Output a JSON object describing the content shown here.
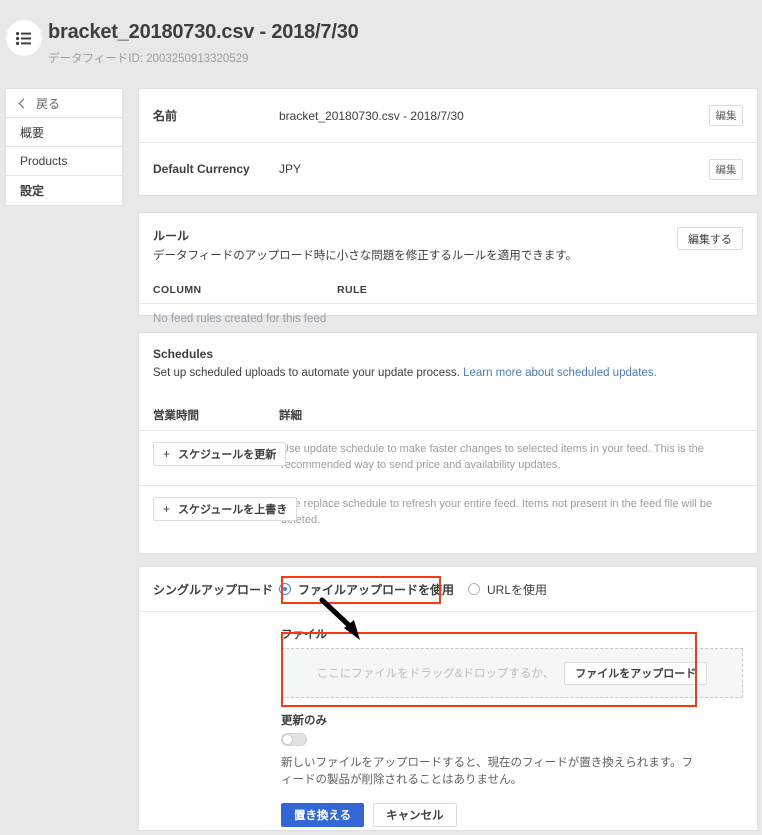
{
  "header": {
    "icon": "list-icon",
    "title": "bracket_20180730.csv - 2018/7/30",
    "subtitle": "データフィードID: 2003250913320529"
  },
  "sidebar": {
    "items": [
      {
        "label": "戻る",
        "icon": "chevron-left-icon",
        "selected": false
      },
      {
        "label": "概要",
        "selected": false
      },
      {
        "label": "Products",
        "selected": false
      },
      {
        "label": "設定",
        "selected": true
      }
    ]
  },
  "basic_card": {
    "rows": [
      {
        "label": "名前",
        "value": "bracket_20180730.csv - 2018/7/30",
        "action": "編集"
      },
      {
        "label": "Default Currency",
        "value": "JPY",
        "action": "編集"
      }
    ]
  },
  "rules_card": {
    "title": "ルール",
    "description": "データフィードのアップロード時に小さな問題を修正するルールを適用できます。",
    "edit_button": "編集する",
    "table": {
      "headers": [
        "COLUMN",
        "RULE"
      ],
      "empty_message": "No feed rules created for this feed"
    }
  },
  "schedules_card": {
    "title": "Schedules",
    "description": "Set up scheduled uploads to automate your update process.",
    "link_text": "Learn more about scheduled updates.",
    "table_headers": [
      "営業時間",
      "詳細"
    ],
    "rows": [
      {
        "button": "スケジュールを更新",
        "description": "Use update schedule to make faster changes to selected items in your feed. This is the recommended way to send price and availability updates."
      },
      {
        "button": "スケジュールを上書き",
        "description": "Use replace schedule to refresh your entire feed. Items not present in the feed file will be deleted."
      }
    ]
  },
  "upload_card": {
    "label": "シングルアップロード",
    "radio_options": [
      {
        "label": "ファイルアップロードを使用",
        "selected": true
      },
      {
        "label": "URLを使用",
        "selected": false
      }
    ],
    "file_field_label": "ファイル",
    "dropzone_text": "ここにファイルをドラッグ&ドロップするか、",
    "dropzone_button": "ファイルをアップロード",
    "toggle_label": "更新のみ",
    "toggle_state": "off",
    "note": "新しいファイルをアップロードすると、現在のフィードが置き換えられます。フィードの製品が削除されることはありません。",
    "primary_button": "置き換える",
    "secondary_button": "キャンセル"
  },
  "annotations": {
    "color": "#f93a10",
    "radio_highlight": "ファイルアップロードを使用",
    "dropzone_highlight": "ファイルをアップロード",
    "arrow": "arrow-down-right"
  },
  "colors": {
    "page_background": "#e6e8ea",
    "card_background": "#ffffff",
    "accent_blue": "#4285f4",
    "primary_button": "#3367d6",
    "link": "#4a7ebb",
    "annotation_red": "#f93a10"
  }
}
